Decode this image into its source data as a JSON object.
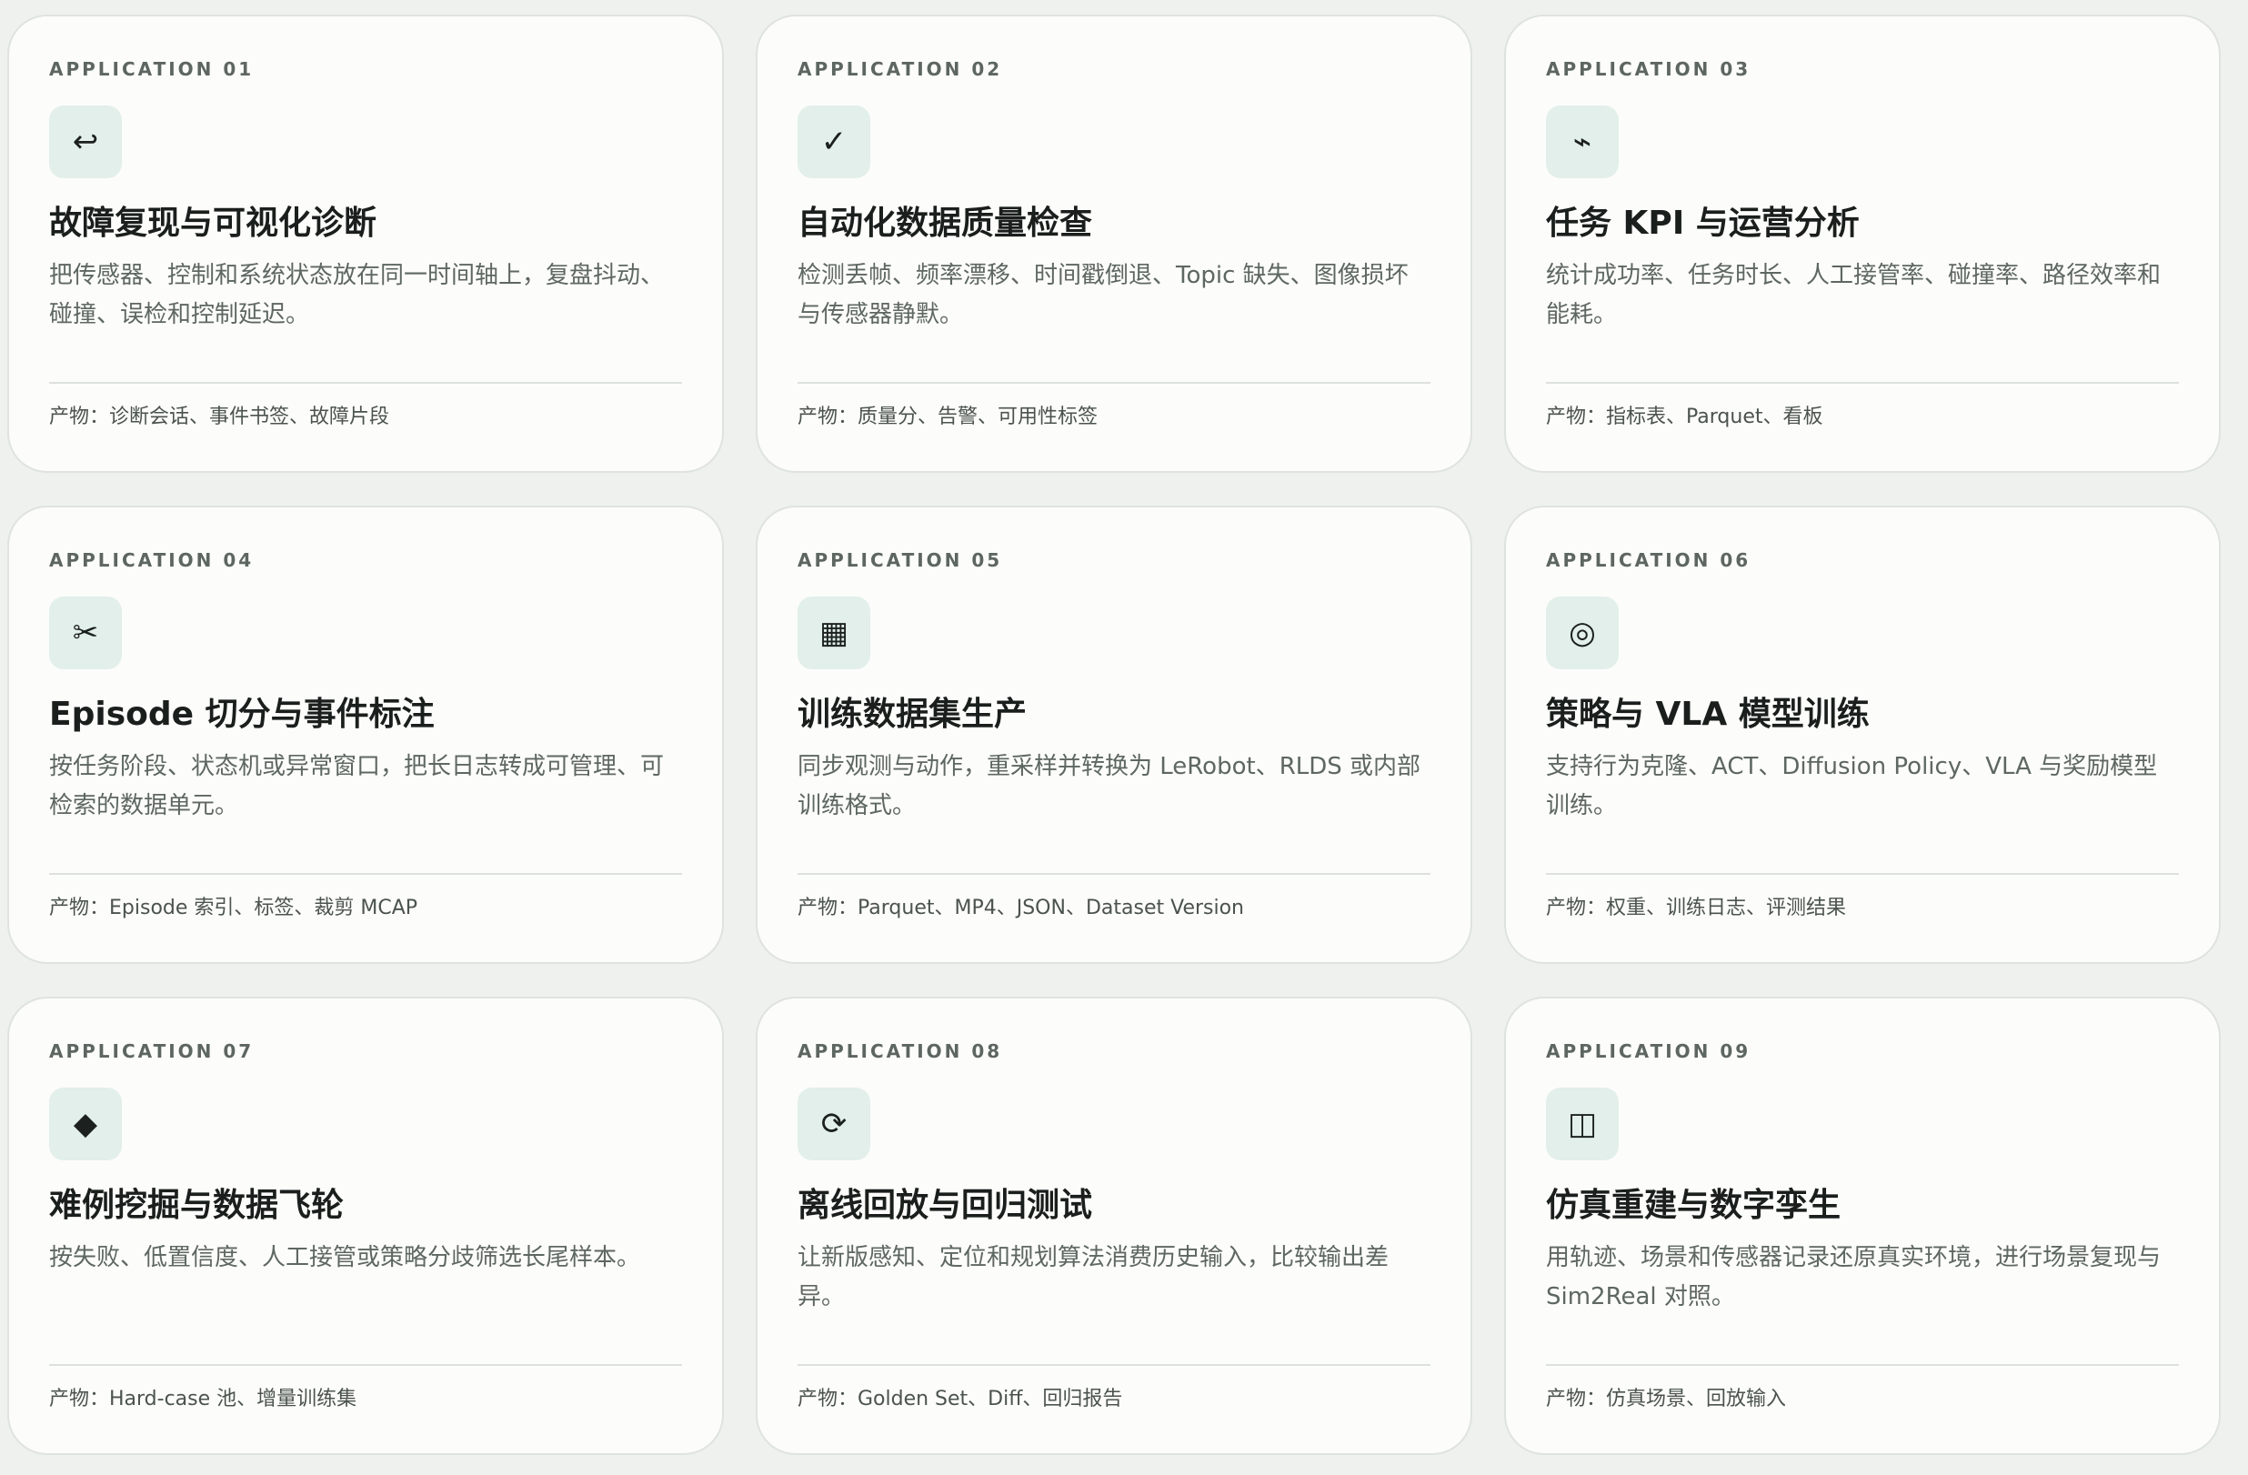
{
  "cards": [
    {
      "label": "APPLICATION 01",
      "icon": "↩",
      "icon_name": "return-arrow-icon",
      "title": "故障复现与可视化诊断",
      "description": "把传感器、控制和系统状态放在同一时间轴上，复盘抖动、碰撞、误检和控制延迟。",
      "output": "产物：诊断会话、事件书签、故障片段"
    },
    {
      "label": "APPLICATION 02",
      "icon": "✓",
      "icon_name": "checkmark-icon",
      "title": "自动化数据质量检查",
      "description": "检测丢帧、频率漂移、时间戳倒退、Topic 缺失、图像损坏与传感器静默。",
      "output": "产物：质量分、告警、可用性标签"
    },
    {
      "label": "APPLICATION 03",
      "icon": "⌁",
      "icon_name": "electric-arrow-icon",
      "title": "任务 KPI 与运营分析",
      "description": "统计成功率、任务时长、人工接管率、碰撞率、路径效率和能耗。",
      "output": "产物：指标表、Parquet、看板"
    },
    {
      "label": "APPLICATION 04",
      "icon": "✂",
      "icon_name": "scissors-icon",
      "title": "Episode 切分与事件标注",
      "description": "按任务阶段、状态机或异常窗口，把长日志转成可管理、可检索的数据单元。",
      "output": "产物：Episode 索引、标签、裁剪 MCAP"
    },
    {
      "label": "APPLICATION 05",
      "icon": "▦",
      "icon_name": "grid-icon",
      "title": "训练数据集生产",
      "description": "同步观测与动作，重采样并转换为 LeRobot、RLDS 或内部训练格式。",
      "output": "产物：Parquet、MP4、JSON、Dataset Version"
    },
    {
      "label": "APPLICATION 06",
      "icon": "◎",
      "icon_name": "target-icon",
      "title": "策略与 VLA 模型训练",
      "description": "支持行为克隆、ACT、Diffusion Policy、VLA 与奖励模型训练。",
      "output": "产物：权重、训练日志、评测结果"
    },
    {
      "label": "APPLICATION 07",
      "icon": "◆",
      "icon_name": "diamond-icon",
      "title": "难例挖掘与数据飞轮",
      "description": "按失败、低置信度、人工接管或策略分歧筛选长尾样本。",
      "output": "产物：Hard-case 池、增量训练集"
    },
    {
      "label": "APPLICATION 08",
      "icon": "⟳",
      "icon_name": "refresh-icon",
      "title": "离线回放与回归测试",
      "description": "让新版感知、定位和规划算法消费历史输入，比较输出差异。",
      "output": "产物：Golden Set、Diff、回归报告"
    },
    {
      "label": "APPLICATION 09",
      "icon": "◫",
      "icon_name": "split-square-icon",
      "title": "仿真重建与数字孪生",
      "description": "用轨迹、场景和传感器记录还原真实环境，进行场景复现与 Sim2Real 对照。",
      "output": "产物：仿真场景、回放输入"
    }
  ]
}
